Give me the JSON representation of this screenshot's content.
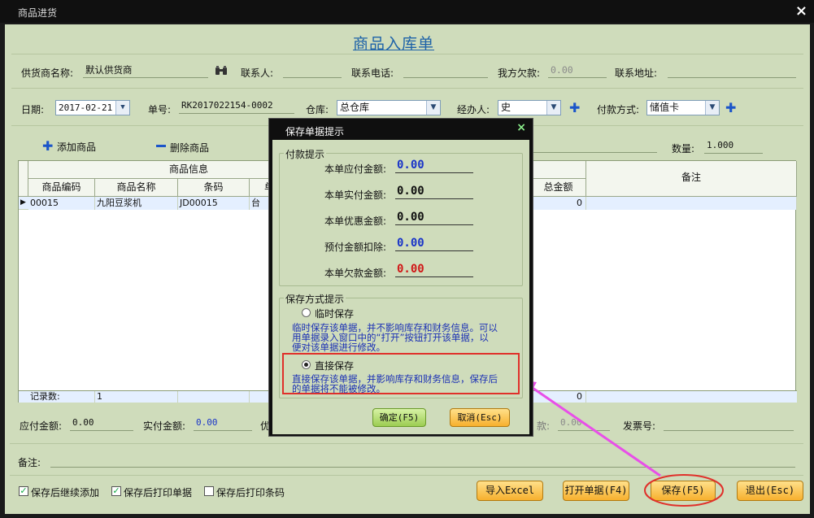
{
  "window": {
    "title": "商品进货",
    "close": "×"
  },
  "form_title": "商品入库单",
  "header": {
    "supplier_label": "供货商名称:",
    "supplier_value": "默认供货商",
    "contact_label": "联系人:",
    "phone_label": "联系电话:",
    "debt_label": "我方欠款:",
    "debt_value": "0.00",
    "address_label": "联系地址:",
    "date_label": "日期:",
    "date_value": "2017-02-21",
    "order_no_label": "单号:",
    "order_no_value": "RK2017022154-0002",
    "warehouse_label": "仓库:",
    "warehouse_value": "总仓库",
    "handler_label": "经办人:",
    "handler_value": "史",
    "payment_label": "付款方式:",
    "payment_value": "储值卡"
  },
  "toolbar": {
    "add_item": "添加商品",
    "delete_item": "删除商品",
    "quantity_label": "数量:",
    "quantity_value": "1.000"
  },
  "grid": {
    "group_header": "商品信息",
    "columns": [
      "商品编码",
      "商品名称",
      "条码",
      "单"
    ],
    "total_col": "总金额",
    "notes_col": "备注",
    "rows": [
      {
        "code": "00015",
        "name": "九阳豆浆机",
        "barcode": "JD00015",
        "unit": "台",
        "total": "0"
      }
    ],
    "footer": {
      "record_label": "记录数:",
      "record_count": "1",
      "total": "0"
    }
  },
  "summary": {
    "payable_label": "应付金额:",
    "payable_value": "0.00",
    "paid_label": "实付金额:",
    "paid_value": "0.00",
    "discount_partial": "优",
    "hidden_partial_label": "款:",
    "hidden_partial_value": "0.00",
    "invoice_label": "发票号:",
    "notes_label": "备注:"
  },
  "options": {
    "continue_add": "保存后继续添加",
    "print_doc": "保存后打印单据",
    "print_barcode": "保存后打印条码"
  },
  "buttons": {
    "import_excel": "导入Excel",
    "open_doc": "打开单据(F4)",
    "save": "保存(F5)",
    "exit": "退出(Esc)"
  },
  "dialog": {
    "title": "保存单据提示",
    "close": "×",
    "payment_group": "付款提示",
    "payable_label": "本单应付金额:",
    "payable_value": "0.00",
    "actual_label": "本单实付金额:",
    "actual_value": "0.00",
    "discount_label": "本单优惠金额:",
    "discount_value": "0.00",
    "prepaid_label": "预付金额扣除:",
    "prepaid_value": "0.00",
    "owed_label": "本单欠款金额:",
    "owed_value": "0.00",
    "save_mode_group": "保存方式提示",
    "temp_save_label": "临时保存",
    "temp_save_desc_1": "临时保存该单据，并不影响库存和财务信息。可以",
    "temp_save_desc_2": "用单据录入窗口中的“打开”按钮打开该单据，以",
    "temp_save_desc_3": "便对该单据进行修改。",
    "direct_save_label": "直接保存",
    "direct_save_desc_1": "直接保存该单据，并影响库存和财务信息，保存后",
    "direct_save_desc_2": "的单据将不能被修改。",
    "confirm": "确定(F5)",
    "cancel": "取消(Esc)"
  },
  "annotation_colors": {
    "highlight": "#e0302a",
    "arrow": "#e84fe8"
  }
}
